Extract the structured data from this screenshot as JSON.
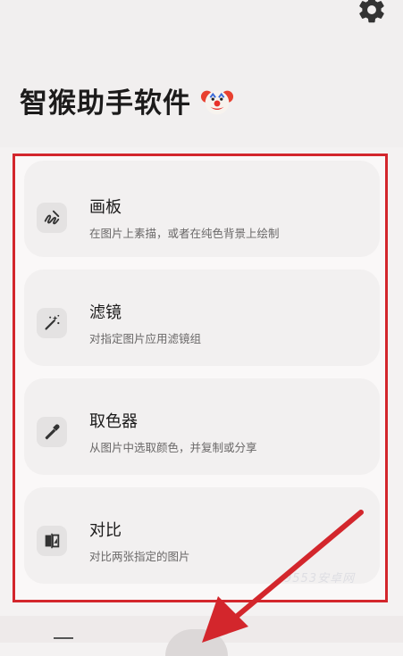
{
  "app": {
    "title": "智猴助手软件"
  },
  "tools": [
    {
      "label": "画板",
      "desc": "在图片上素描，或者在纯色背景上绘制",
      "icon": "draw-icon"
    },
    {
      "label": "滤镜",
      "desc": "对指定图片应用滤镜组",
      "icon": "magic-wand-icon"
    },
    {
      "label": "取色器",
      "desc": "从图片中选取颜色，并复制或分享",
      "icon": "eyedropper-icon"
    },
    {
      "label": "对比",
      "desc": "对比两张指定的图片",
      "icon": "compare-icon"
    }
  ],
  "watermark": "9553安卓网",
  "colors": {
    "highlight_border": "#d3262c",
    "arrow": "#d3262c"
  }
}
